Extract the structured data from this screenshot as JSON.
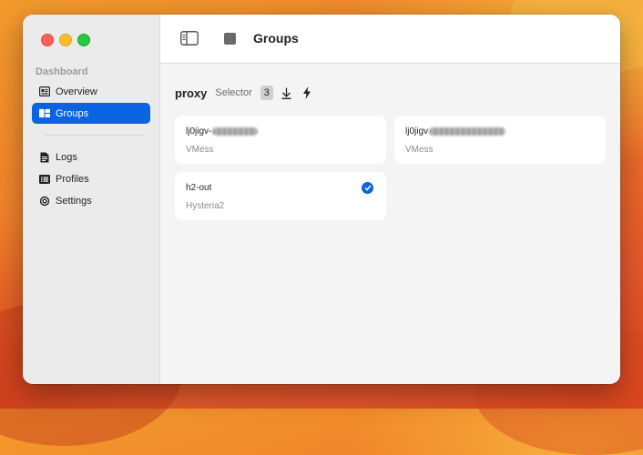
{
  "sidebar": {
    "section_title": "Dashboard",
    "items": [
      {
        "label": "Overview",
        "icon": "overview-icon",
        "active": false
      },
      {
        "label": "Groups",
        "icon": "groups-icon",
        "active": true
      },
      {
        "label": "Logs",
        "icon": "logs-icon",
        "active": false
      },
      {
        "label": "Profiles",
        "icon": "profiles-icon",
        "active": false
      },
      {
        "label": "Settings",
        "icon": "settings-icon",
        "active": false
      }
    ]
  },
  "toolbar": {
    "title": "Groups"
  },
  "group": {
    "name": "proxy",
    "type": "Selector",
    "count": "3"
  },
  "proxies": [
    {
      "name": "lj0jigv-",
      "type": "VMess",
      "selected": false
    },
    {
      "name": "lj0jigv",
      "type": "VMess",
      "selected": false
    },
    {
      "name": "h2-out",
      "type": "Hysteria2",
      "selected": true
    }
  ],
  "colors": {
    "accent": "#0a63e0",
    "window_bg": "#f4f4f4",
    "card_bg": "#ffffff"
  }
}
